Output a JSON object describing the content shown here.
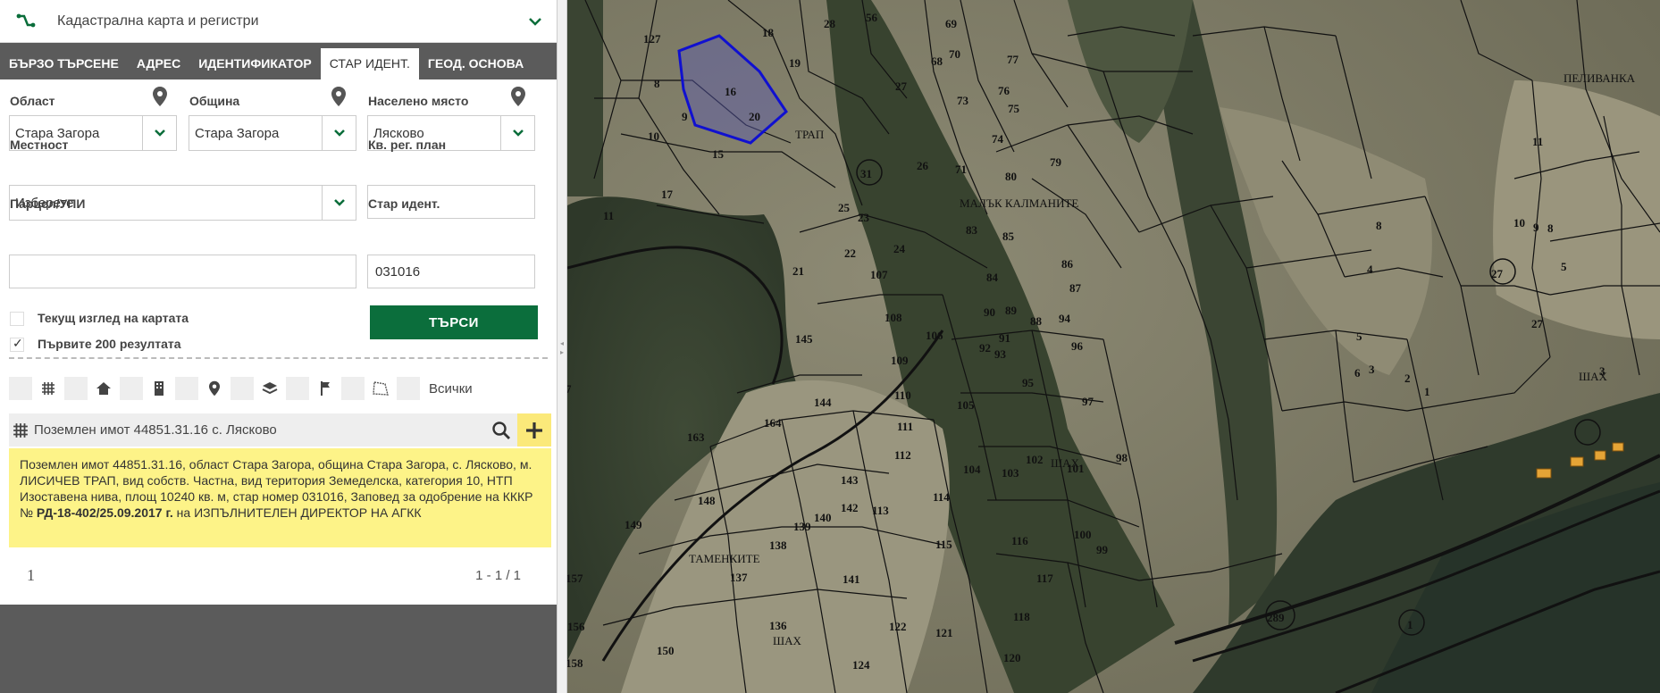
{
  "header": {
    "title": "Кадастрална карта и регистри"
  },
  "tabs": [
    {
      "label": "БЪРЗО ТЪРСЕНЕ"
    },
    {
      "label": "АДРЕС"
    },
    {
      "label": "ИДЕНТИФИКАТОР"
    },
    {
      "label": "СТАР ИДЕНТ."
    },
    {
      "label": "ГЕОД. ОСНОВА"
    }
  ],
  "form": {
    "region_label": "Област",
    "region_value": "Стара Загора",
    "municipality_label": "Община",
    "municipality_value": "Стара Загора",
    "settlement_label": "Населено място",
    "settlement_value": "Лясково",
    "locality_label": "Местност",
    "locality_value": "Изберете",
    "block_label": "Кв. рег. план",
    "block_value": "",
    "parcel_label": "Парцел/УПИ",
    "parcel_value": "",
    "old_id_label": "Стар идент.",
    "old_id_value": "031016",
    "current_view_label": "Текущ изглед на картата",
    "current_view_checked": false,
    "first200_label": "Първите 200 резултата",
    "first200_checked": true,
    "search_button": "ТЪРСИ"
  },
  "filters": {
    "all_label": "Всички",
    "icons": [
      "grid-icon",
      "home-icon",
      "building-icon",
      "pin-icon",
      "layers-icon",
      "flag-icon",
      "polygon-icon"
    ]
  },
  "result": {
    "title": "Поземлен имот 44851.31.16 с. Лясково",
    "info_plain": "Поземлен имот 44851.31.16, област Стара Загора, община Стара Загора, с. Лясково, м. ЛИСИЧЕВ ТРАП, вид собств. Частна, вид територия Земеделска, категория 10, НТП Изоставена нива, площ 10240 кв. м, стар номер 031016, Заповед за одобрение на КККР № ",
    "info_bold": "РД-18-402/25.09.2017 г.",
    "info_tail": " на ИЗПЪЛНИТЕЛЕН ДИРЕКТОР НА АГКК",
    "page": "1",
    "range": "1 - 1 / 1"
  },
  "map": {
    "colors": {
      "accent": "#0b6e3c",
      "highlight": "#1010d0",
      "highlight_fill": "#5a5ab0"
    },
    "parcel_labels": [
      "127",
      "8",
      "9",
      "10",
      "15",
      "17",
      "11",
      "16",
      "18",
      "19",
      "20",
      "28",
      "56",
      "27",
      "69",
      "68",
      "73",
      "76",
      "74",
      "75",
      "77",
      "72",
      "71",
      "70",
      "26",
      "31",
      "25",
      "24",
      "23",
      "22",
      "21",
      "80",
      "79",
      "85",
      "83",
      "86",
      "87",
      "84",
      "89",
      "90",
      "92",
      "91",
      "93",
      "88",
      "94",
      "96",
      "95",
      "97",
      "98",
      "101",
      "99",
      "100",
      "102",
      "103",
      "104",
      "105",
      "106",
      "107",
      "108",
      "109",
      "110",
      "111",
      "112",
      "113",
      "114",
      "115",
      "116",
      "117",
      "118",
      "120",
      "121",
      "122",
      "124",
      "136",
      "137",
      "138",
      "139",
      "140",
      "141",
      "142",
      "143",
      "144",
      "145",
      "148",
      "149",
      "150",
      "156",
      "157",
      "158",
      "163",
      "164",
      "7",
      "6",
      "5",
      "4",
      "3",
      "2",
      "1",
      "9",
      "8",
      "10",
      "11",
      "27",
      "289",
      "1",
      "5"
    ],
    "place_names": [
      "МАЛЪК КАЛМАНИТЕ",
      "ТАМЕНКИТЕ",
      "ПЕЛИВАНКА",
      "ТРАП",
      "ШАХ",
      "ШАХ",
      "ШАХ"
    ],
    "circle_labels": [
      "31",
      "27",
      "289",
      "1"
    ]
  }
}
